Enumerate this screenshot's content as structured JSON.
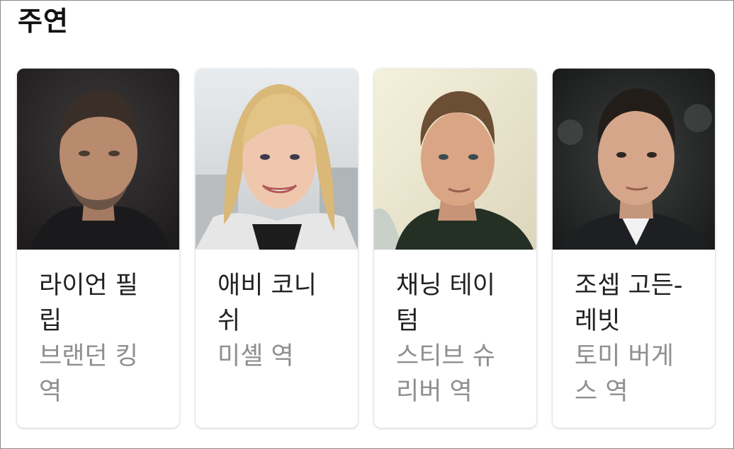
{
  "section": {
    "title": "주연"
  },
  "cast": [
    {
      "name": "라이언 필립",
      "role": "브랜던 킹 역",
      "photo": "actor-photo-man-dark-background"
    },
    {
      "name": "애비 코니쉬",
      "role": "미셸 역",
      "photo": "actor-photo-blonde-woman-smiling"
    },
    {
      "name": "채닝 테이텀",
      "role": "스티브 슈리버 역",
      "photo": "actor-photo-man-light-background"
    },
    {
      "name": "조셉 고든-레빗",
      "role": "토미 버게스 역",
      "photo": "actor-photo-man-dark-hair-suit"
    }
  ]
}
